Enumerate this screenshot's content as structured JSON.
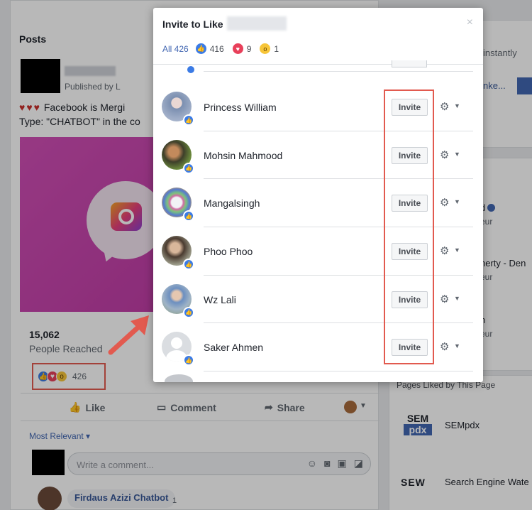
{
  "background": {
    "posts_title": "Posts",
    "published_by": "Published by L",
    "post_text_line1": "Facebook is Mergi",
    "post_text_line2": "Type: \"CHATBOT\" in the co",
    "hearts": "♥♥♥",
    "reach_count": "15,062",
    "reach_label": "People Reached",
    "reactions_count": "426",
    "actions": {
      "like": "Like",
      "comment": "Comment",
      "share": "Share"
    },
    "most_relevant": "Most Relevant",
    "comment_placeholder": "Write a comment...",
    "reply_name": "Firdaus Azizi Chatbot",
    "reply_reaction_count": "1",
    "right_instantly": "instantly",
    "right_link": "nke...",
    "right_row1": "d",
    "right_row1_sub": "eur",
    "right_row2": "herty - Den",
    "right_row2_sub": "eur",
    "right_row3": "n",
    "right_row3_sub": "eur",
    "pages_liked_title": "Pages Liked by This Page",
    "sem_logo_top": "SEM",
    "sem_logo_bottom": "pdx",
    "sem_name": "SEMpdx",
    "sew_logo": "SEW",
    "sew_name": "Search Engine Wate"
  },
  "modal": {
    "title": "Invite to Like",
    "close": "×",
    "filters": {
      "all": "All 426",
      "like_count": "416",
      "love_count": "9",
      "wow_count": "1"
    },
    "people": [
      {
        "name": "Princess William",
        "button": "Invite"
      },
      {
        "name": "Mohsin Mahmood",
        "button": "Invite"
      },
      {
        "name": "Mangalsingh",
        "button": "Invite"
      },
      {
        "name": "Phoo Phoo",
        "button": "Invite"
      },
      {
        "name": "Wz Lali",
        "button": "Invite"
      },
      {
        "name": "Saker Ahmen",
        "button": "Invite"
      }
    ]
  },
  "colors": {
    "accent": "#4267b2",
    "like_blue": "#3b7be5",
    "love_red": "#e8405a",
    "wow_yellow": "#f7c538",
    "annotation_red": "#e25a4f"
  },
  "icons": [
    "like-icon",
    "love-icon",
    "wow-icon",
    "gear-icon",
    "close-icon",
    "chevron-down-icon",
    "thumbs-up-icon",
    "comment-icon",
    "share-icon",
    "emoji-icon",
    "camera-icon",
    "gif-icon",
    "sticker-icon"
  ]
}
